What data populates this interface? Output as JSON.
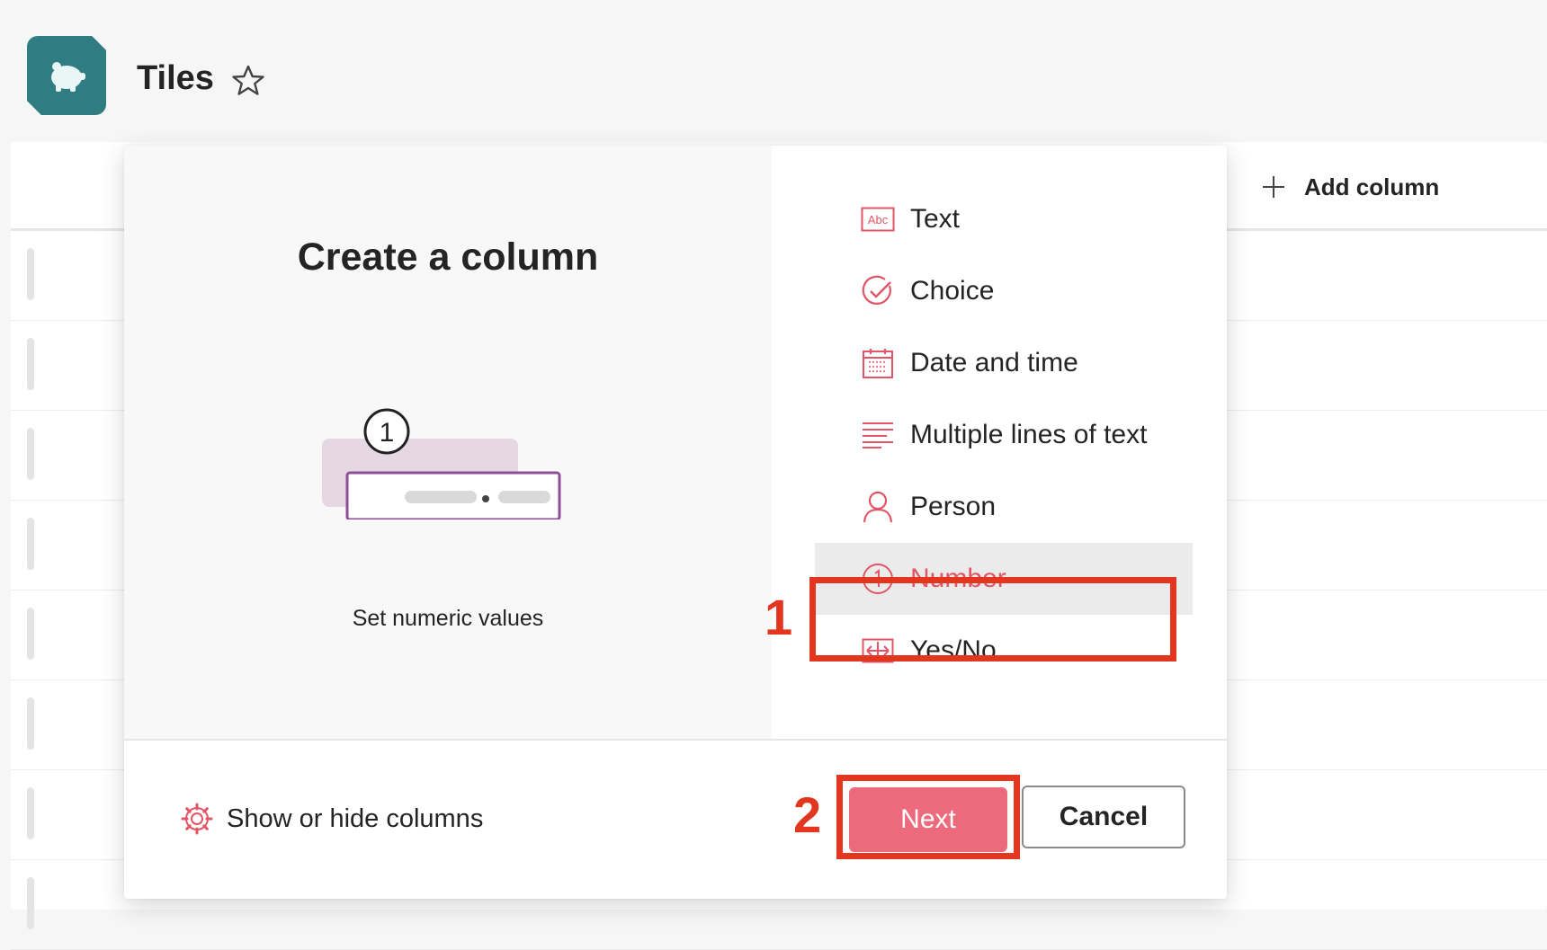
{
  "site": {
    "title": "Tiles",
    "logo_icon": "piggy-bank-icon",
    "favorite_icon": "star-outline-icon"
  },
  "list": {
    "add_column_label": "Add column",
    "row_count": 8
  },
  "dialog": {
    "title": "Create a column",
    "preview_description": "Set numeric values",
    "illustration_number": "1",
    "column_types": [
      {
        "label": "Text",
        "icon": "text-abc-icon"
      },
      {
        "label": "Choice",
        "icon": "choice-check-icon"
      },
      {
        "label": "Date and time",
        "icon": "calendar-icon"
      },
      {
        "label": "Multiple lines of text",
        "icon": "multiline-text-icon"
      },
      {
        "label": "Person",
        "icon": "person-icon"
      },
      {
        "label": "Number",
        "icon": "number-icon",
        "selected": true
      },
      {
        "label": "Yes/No",
        "icon": "yes-no-icon"
      }
    ],
    "footer": {
      "show_hide_label": "Show or hide columns",
      "next_label": "Next",
      "cancel_label": "Cancel"
    }
  },
  "annotations": {
    "step_1": "1",
    "step_2": "2"
  },
  "colors": {
    "accent": "#e25567",
    "next_button": "#ec6a7b",
    "annotation_red": "#e2361e",
    "logo_teal": "#2f7d83"
  }
}
